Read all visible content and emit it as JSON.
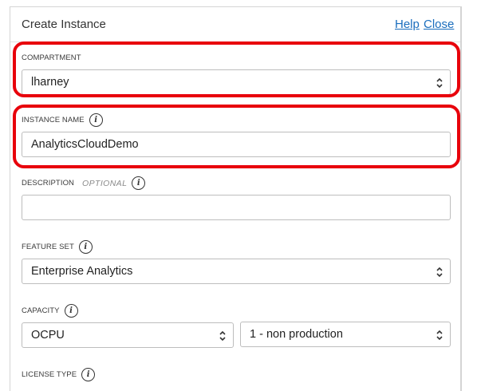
{
  "dialog": {
    "title": "Create Instance",
    "help_link": "Help",
    "close_link": "Close"
  },
  "compartment": {
    "label": "COMPARTMENT",
    "value": "lharney"
  },
  "instance_name": {
    "label": "INSTANCE NAME",
    "value": "AnalyticsCloudDemo"
  },
  "description": {
    "label": "DESCRIPTION",
    "optional": "OPTIONAL",
    "value": ""
  },
  "feature_set": {
    "label": "FEATURE SET",
    "value": "Enterprise Analytics"
  },
  "capacity": {
    "label": "CAPACITY",
    "unit_value": "OCPU",
    "amount_value": "1 - non production"
  },
  "license_type": {
    "label": "LICENSE TYPE"
  },
  "icons": {
    "info": "info-icon",
    "select": "chevron-up-down-icon"
  },
  "colors": {
    "highlight": "#e8000b",
    "link": "#1a6dbd",
    "field_border": "#bdbdbd"
  }
}
